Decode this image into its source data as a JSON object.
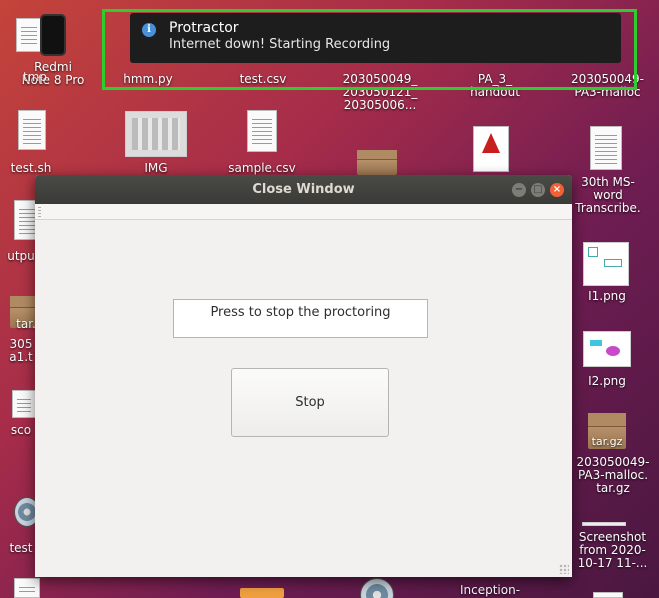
{
  "notification": {
    "title": "Protractor",
    "body": "Internet down! Starting Recording",
    "icon": "info-icon"
  },
  "desktop": {
    "icons": [
      {
        "name": "redmi-note-8-pro",
        "label_lines": [
          "Redmi",
          "Note 8 Pro"
        ],
        "overlap_label": "tmp"
      },
      {
        "name": "hmm-py",
        "label_lines": [
          "hmm.py"
        ]
      },
      {
        "name": "test-csv",
        "label_lines": [
          "test.csv"
        ]
      },
      {
        "name": "folder-203050049",
        "label_lines": [
          "203050049_",
          "203050121_",
          "20305006..."
        ]
      },
      {
        "name": "pa-3-handout",
        "label_lines": [
          "PA_3_",
          "handout"
        ]
      },
      {
        "name": "pa3-malloc-top",
        "label_lines": [
          "203050049-",
          "PA3-malloc"
        ]
      },
      {
        "name": "test-sh",
        "label_lines": [
          "test.sh"
        ]
      },
      {
        "name": "img",
        "label_lines": [
          "IMG"
        ]
      },
      {
        "name": "sample-csv",
        "label_lines": [
          "sample.csv"
        ]
      },
      {
        "name": "word-transcribe",
        "label_lines": [
          "30th MS-",
          "word",
          "Transcribe."
        ]
      },
      {
        "name": "outpu",
        "label_lines": [
          "utpu"
        ]
      },
      {
        "name": "i1-png",
        "label_lines": [
          "I1.png"
        ]
      },
      {
        "name": "tar-left",
        "label_lines": [
          "tar."
        ]
      },
      {
        "name": "a1-t",
        "label_lines": [
          "305",
          "a1.t"
        ]
      },
      {
        "name": "i2-png",
        "label_lines": [
          "I2.png"
        ]
      },
      {
        "name": "sco",
        "label_lines": [
          "sco"
        ]
      },
      {
        "name": "tar-gz-label",
        "label_lines": [
          "tar.gz"
        ]
      },
      {
        "name": "pa3-malloc-tar",
        "label_lines": [
          "203050049-",
          "PA3-malloc.",
          "tar.gz"
        ]
      },
      {
        "name": "test-disc",
        "label_lines": [
          "test"
        ]
      },
      {
        "name": "screenshot",
        "label_lines": [
          "Screenshot",
          "from 2020-",
          "10-17 11-..."
        ]
      },
      {
        "name": "inception",
        "label_lines": [
          "Inception-"
        ]
      }
    ]
  },
  "window": {
    "title": "Close Window",
    "message": "Press to stop the proctoring",
    "stop_label": "Stop",
    "controls": {
      "minimize": "−",
      "maximize": "□",
      "close": "×"
    }
  }
}
